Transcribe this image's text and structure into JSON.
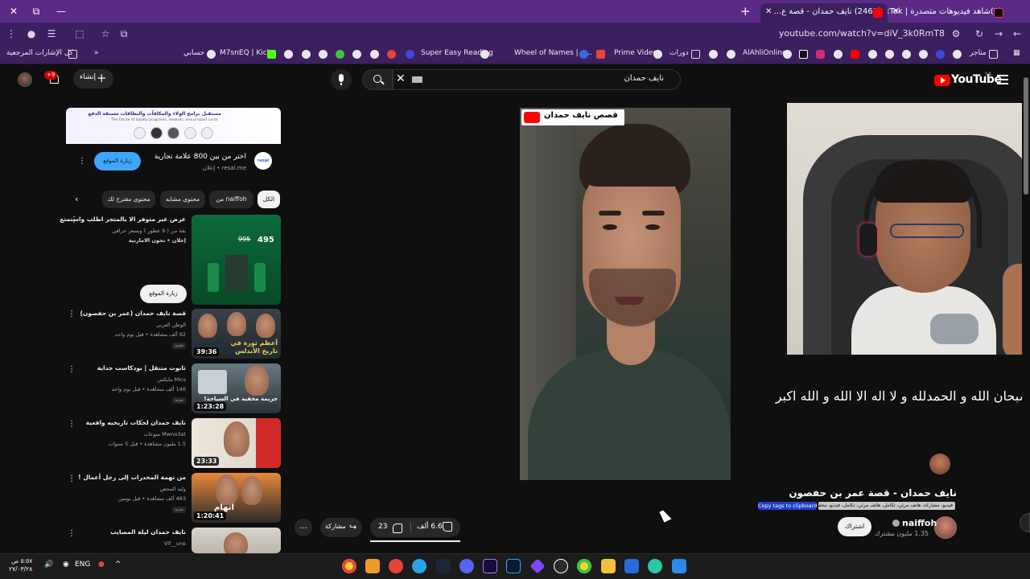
{
  "tabs": [
    {
      "label": "(2465) نايف حمدان - قصة ع...",
      "active": true
    },
    {
      "label": "(2)شاهد فيديوهات متصدرة | TikTok",
      "active": false
    }
  ],
  "address": {
    "url": "youtube.com/watch?v=diV_3k0RmT8"
  },
  "bookmarks": [
    "كل الإشارات المرجعية",
    "حسابي",
    "M7snEQ | Kick",
    "Super Easy Reading",
    "Wheel of Names | م...",
    "Prime Video",
    "دورات",
    "AlAhliOnline",
    "متاجر"
  ],
  "header": {
    "logo": "YouTube",
    "region": "SA",
    "search_query": "نايف حمدان",
    "create_label": "إنشاء",
    "notifications": "+9"
  },
  "video": {
    "overlay_tag": "قصص نايف حمدان",
    "overlay_caption": "سبحان الله و الحمدلله و  لا اله الا الله و الله اكبر",
    "title": "نايف حمدان - قصة عمر بن حفصون",
    "tags_text": "فيديو، مشاركة، هاتف مرئي، تكامل، هاتف مرئي، تكامل، فيديو، محفظة، تحميل",
    "copy_tags_label": "Copy tags to clipboard",
    "channel_name": "naiffoh",
    "subscribers": "1.35 مليون مشترك",
    "subscribe_label": "اشتراك",
    "likes": "6.6 ألف",
    "dislikes": "23",
    "share_label": "مشاركة",
    "more_label": "..."
  },
  "ad": {
    "banner_line1": "مستقبل برامج الولاء والمكافآت والبطاقات مسبقة الدفع",
    "banner_line2": "The future of loyalty programs, rewards, and prepaid cards",
    "logo": "resal",
    "title": "اختر من بين 800 علامة تجارية",
    "sponsor_label": "إعلان",
    "domain": "resal.me",
    "visit_label": "زيارة الموقع"
  },
  "chips": [
    "الكل",
    "من naiffoh",
    "محتوى مشابه",
    "محتوى مقترح لك"
  ],
  "recommendations": [
    {
      "title": "عرض عبر متوفر الا بالمتجر اطلب واستمتع",
      "channel": "بقة من ( 9 عطور ) وبسعر خرافي",
      "meta": "إعلان • تخون الامارتية",
      "duration": "",
      "badge": "",
      "is_ad": true,
      "visit_label": "زيارة الموقع",
      "price1": "995",
      "price2": "495"
    },
    {
      "title": "قصة نايف حمدان (عمر بن حفصون)",
      "channel": "الوطن العربي",
      "meta": "92 ألف مشاهدة • قبل يوم واحد",
      "duration": "39:36",
      "badge": "جديد",
      "thumb_text": "أعظم ثورة في تاريخ الأندلس"
    },
    {
      "title": "ثابوت متنقل | بودكاست جداية",
      "channel": "Mics مايكس",
      "meta": "146 ألف مشاهدة • قبل يوم واحد",
      "duration": "1:23:28",
      "badge": "جديد",
      "thumb_text": "جريمة مخفية في السياحة!"
    },
    {
      "title": "نايف حمدان لحكات تاريخيه وافعية",
      "channel": "Mwno3at منوعات",
      "meta": "1.5 مليون مشاهدة • قبل 5 سنوات",
      "duration": "23:33",
      "badge": ""
    },
    {
      "title": "من تهمة المخدرات إلى رجل أعمال !",
      "channel": "وليد المحص",
      "meta": "483 ألف مشاهدة • قبل يومين",
      "duration": "1:20:41",
      "badge": "جديد",
      "thumb_text": "اتهام"
    },
    {
      "title": "نايف حمدان ليلة المصايب",
      "channel": "Vlf__une",
      "meta": "",
      "duration": "",
      "badge": ""
    }
  ],
  "taskbar": {
    "time": "٥:٥٧ ص",
    "date": "٢٧/٠٣/٢٨",
    "lang": "ENG"
  },
  "colors": {
    "chrome_frame": "#5b2a87",
    "yt_red": "#ff0000",
    "page_bg": "#0f0f0f",
    "visit_blue": "#3ea6ff"
  }
}
